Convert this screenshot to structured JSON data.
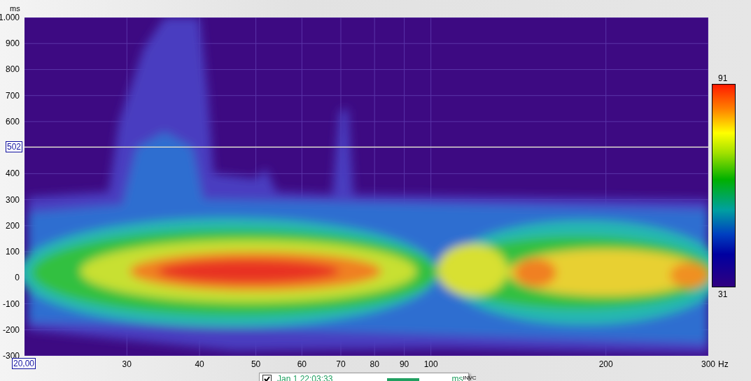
{
  "y_axis": {
    "unit": "ms",
    "ticks": [
      "1.000",
      "900",
      "800",
      "700",
      "600",
      "400",
      "300",
      "200",
      "100",
      "0",
      "-100",
      "-200",
      "-300"
    ]
  },
  "x_axis": {
    "unit": "Hz",
    "ticks": [
      "30",
      "40",
      "50",
      "60",
      "70",
      "80",
      "90",
      "100",
      "200",
      "300"
    ]
  },
  "cursor": {
    "time_label": "502",
    "freq_label": "20,00"
  },
  "color_scale": {
    "max": "91",
    "min": "31"
  },
  "legend": {
    "entries": [
      {
        "checked": true,
        "label": "Jan 1 22:03:33",
        "unit": "ms",
        "tag": "INVC",
        "color": "#20a060"
      }
    ]
  }
}
